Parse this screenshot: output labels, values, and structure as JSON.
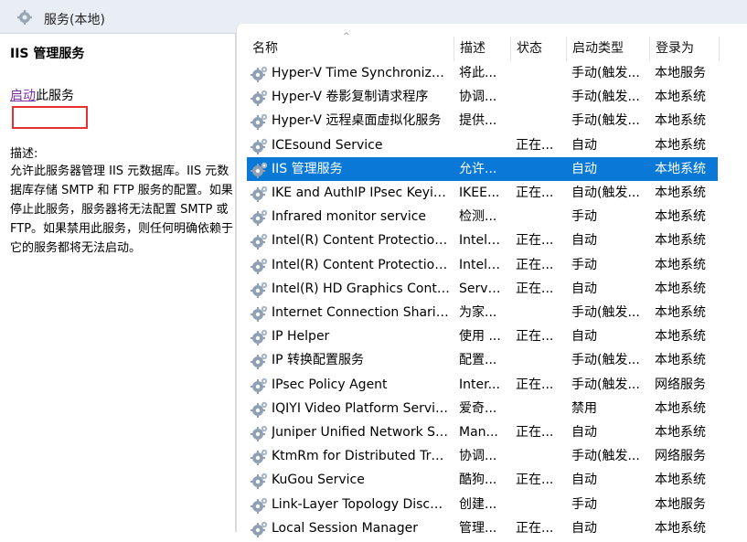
{
  "window": {
    "title": "服务(本地)"
  },
  "left": {
    "service_name": "IIS 管理服务",
    "action_link": "启动",
    "action_suffix": "此服务",
    "desc_label": "描述:",
    "description": "允许此服务器管理 IIS 元数据库。IIS 元数据库存储 SMTP 和 FTP 服务的配置。如果停止此服务，服务器将无法配置 SMTP 或 FTP。如果禁用此服务，则任何明确依赖于它的服务都将无法启动。"
  },
  "table": {
    "headers": {
      "name": "名称",
      "desc": "描述",
      "status": "状态",
      "startup": "启动类型",
      "logon": "登录为"
    },
    "selected_index": 4,
    "rows": [
      {
        "name": "Hyper-V Time Synchronization Service",
        "desc": "将此...",
        "status": "",
        "startup": "手动(触发...",
        "logon": "本地服务"
      },
      {
        "name": "Hyper-V 卷影复制请求程序",
        "desc": "协调...",
        "status": "",
        "startup": "手动(触发...",
        "logon": "本地系统"
      },
      {
        "name": "Hyper-V 远程桌面虚拟化服务",
        "desc": "提供...",
        "status": "",
        "startup": "手动(触发...",
        "logon": "本地系统"
      },
      {
        "name": "ICEsound Service",
        "desc": "",
        "status": "正在...",
        "startup": "自动",
        "logon": "本地系统"
      },
      {
        "name": "IIS 管理服务",
        "desc": "允许...",
        "status": "",
        "startup": "自动",
        "logon": "本地系统"
      },
      {
        "name": "IKE and AuthIP IPsec Keying Modules",
        "desc": "IKEE...",
        "status": "正在...",
        "startup": "自动(触发...",
        "logon": "本地系统"
      },
      {
        "name": "Infrared monitor service",
        "desc": "检测...",
        "status": "",
        "startup": "手动",
        "logon": "本地系统"
      },
      {
        "name": "Intel(R) Content Protection HDCP Service",
        "desc": "Intel(...",
        "status": "正在...",
        "startup": "自动",
        "logon": "本地系统"
      },
      {
        "name": "Intel(R) Content Protection HECI Service",
        "desc": "Intel(...",
        "status": "正在...",
        "startup": "手动",
        "logon": "本地系统"
      },
      {
        "name": "Intel(R) HD Graphics Control Panel Service",
        "desc": "Servi...",
        "status": "正在...",
        "startup": "自动",
        "logon": "本地系统"
      },
      {
        "name": "Internet Connection Sharing (ICS)",
        "desc": "为家...",
        "status": "",
        "startup": "手动(触发...",
        "logon": "本地系统"
      },
      {
        "name": "IP Helper",
        "desc": "使用 ...",
        "status": "正在...",
        "startup": "自动",
        "logon": "本地系统"
      },
      {
        "name": "IP 转换配置服务",
        "desc": "配置...",
        "status": "",
        "startup": "手动(触发...",
        "logon": "本地系统"
      },
      {
        "name": "IPsec Policy Agent",
        "desc": "Inter...",
        "status": "正在...",
        "startup": "手动(触发...",
        "logon": "网络服务"
      },
      {
        "name": "IQIYI Video Platform Service",
        "desc": "爱奇...",
        "status": "",
        "startup": "禁用",
        "logon": "本地系统"
      },
      {
        "name": "Juniper Unified Network Service",
        "desc": "Man...",
        "status": "正在...",
        "startup": "自动",
        "logon": "本地系统"
      },
      {
        "name": "KtmRm for Distributed Transaction Coordinator",
        "desc": "协调...",
        "status": "",
        "startup": "手动(触发...",
        "logon": "网络服务"
      },
      {
        "name": "KuGou Service",
        "desc": "酷狗...",
        "status": "正在...",
        "startup": "自动",
        "logon": "本地系统"
      },
      {
        "name": "Link-Layer Topology Discovery Mapper",
        "desc": "创建...",
        "status": "",
        "startup": "手动",
        "logon": "本地服务"
      },
      {
        "name": "Local Session Manager",
        "desc": "管理...",
        "status": "正在...",
        "startup": "自动",
        "logon": "本地系统"
      }
    ]
  }
}
